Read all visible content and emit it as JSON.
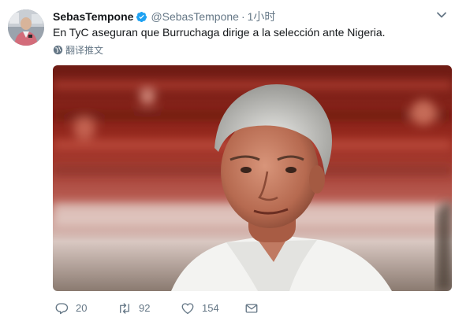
{
  "tweet": {
    "display_name": "SebasTempone",
    "handle": "@SebasTempone",
    "separator": "·",
    "time": "1小时",
    "text": "En TyC aseguran que Burruchaga dirige a la selección ante Nigeria.",
    "translate_label": "翻译推文",
    "media_alt": "photo of a grey-haired man in a white shirt"
  },
  "actions": {
    "reply_count": "20",
    "retweet_count": "92",
    "like_count": "154"
  },
  "colors": {
    "verified": "#1da1f2",
    "secondary_text": "#657786",
    "primary_text": "#14171a"
  },
  "icons": [
    "avatar",
    "verified-badge-icon",
    "chevron-down-icon",
    "globe-icon",
    "reply-icon",
    "retweet-icon",
    "heart-icon",
    "envelope-icon"
  ]
}
